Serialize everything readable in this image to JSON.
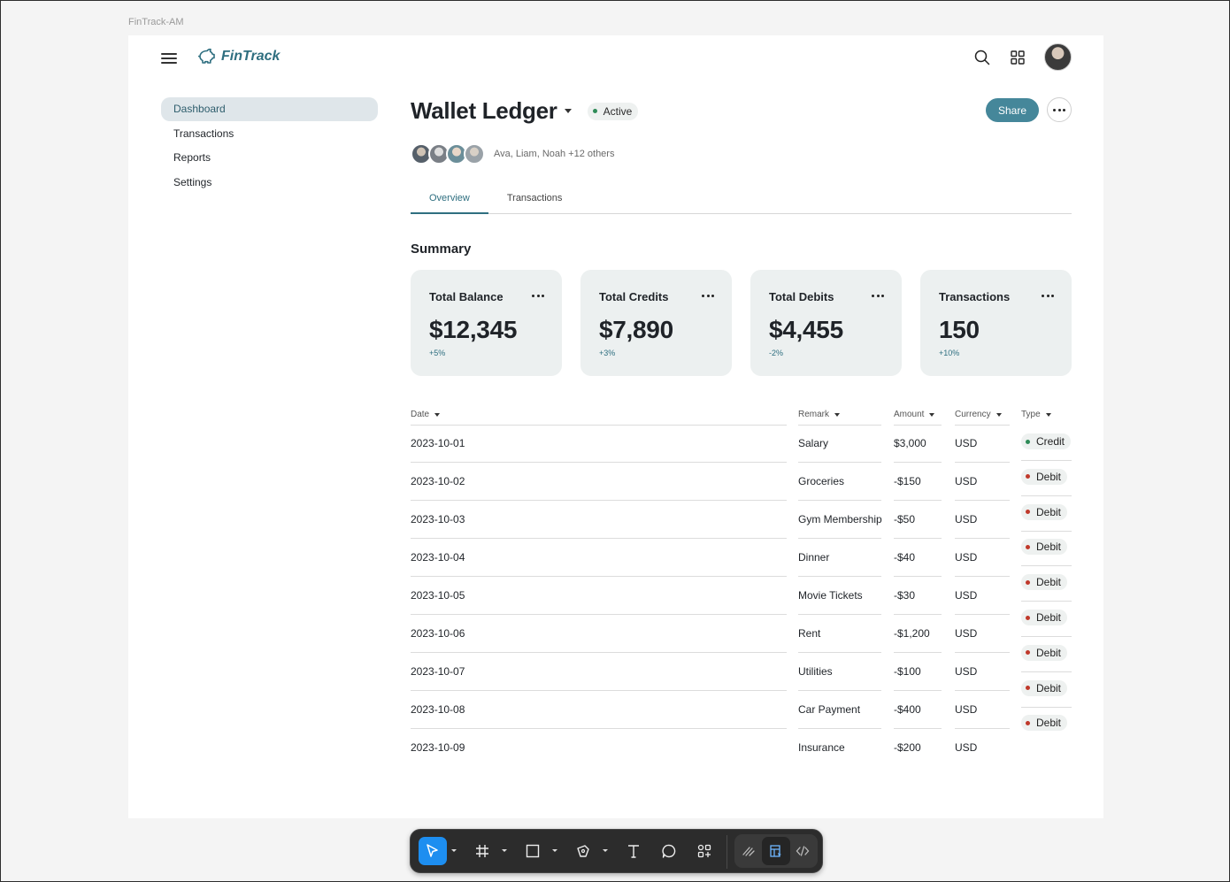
{
  "frame_label": "FinTrack-AM",
  "app": {
    "logo_text": "FinTrack"
  },
  "sidebar": {
    "items": [
      {
        "label": "Dashboard"
      },
      {
        "label": "Transactions"
      },
      {
        "label": "Reports"
      },
      {
        "label": "Settings"
      }
    ]
  },
  "page": {
    "title": "Wallet Ledger",
    "status": "Active",
    "status_color": "#2e8b57",
    "members_text": "Ava, Liam, Noah +12 others",
    "share_label": "Share"
  },
  "tabs": [
    {
      "label": "Overview"
    },
    {
      "label": "Transactions"
    }
  ],
  "summary": {
    "title": "Summary",
    "cards": [
      {
        "title": "Total Balance",
        "value": "$12,345",
        "delta": "+5%"
      },
      {
        "title": "Total Credits",
        "value": "$7,890",
        "delta": "+3%"
      },
      {
        "title": "Total Debits",
        "value": "$4,455",
        "delta": "-2%"
      },
      {
        "title": "Transactions",
        "value": "150",
        "delta": "+10%"
      }
    ]
  },
  "table": {
    "headers": {
      "date": "Date",
      "remark": "Remark",
      "amount": "Amount",
      "currency": "Currency",
      "type": "Type"
    },
    "rows": [
      {
        "date": "2023-10-01",
        "remark": "Salary",
        "amount": "$3,000",
        "currency": "USD",
        "type": "Credit"
      },
      {
        "date": "2023-10-02",
        "remark": "Groceries",
        "amount": "-$150",
        "currency": "USD",
        "type": "Debit"
      },
      {
        "date": "2023-10-03",
        "remark": "Gym Membership",
        "amount": "-$50",
        "currency": "USD",
        "type": "Debit"
      },
      {
        "date": "2023-10-04",
        "remark": "Dinner",
        "amount": "-$40",
        "currency": "USD",
        "type": "Debit"
      },
      {
        "date": "2023-10-05",
        "remark": "Movie Tickets",
        "amount": "-$30",
        "currency": "USD",
        "type": "Debit"
      },
      {
        "date": "2023-10-06",
        "remark": "Rent",
        "amount": "-$1,200",
        "currency": "USD",
        "type": "Debit"
      },
      {
        "date": "2023-10-07",
        "remark": "Utilities",
        "amount": "-$100",
        "currency": "USD",
        "type": "Debit"
      },
      {
        "date": "2023-10-08",
        "remark": "Car Payment",
        "amount": "-$400",
        "currency": "USD",
        "type": "Debit"
      },
      {
        "date": "2023-10-09",
        "remark": "Insurance",
        "amount": "-$200",
        "currency": "USD",
        "type": "Debit"
      }
    ],
    "type_colors": {
      "Credit": "#2e8b57",
      "Debit": "#c0392b"
    }
  },
  "toolbar": {
    "tools": [
      "move-tool",
      "frame-tool",
      "rectangle-tool",
      "pen-tool",
      "text-tool",
      "comment-tool",
      "components-tool"
    ],
    "modes": [
      "draw-mode",
      "design-mode",
      "dev-mode"
    ]
  }
}
